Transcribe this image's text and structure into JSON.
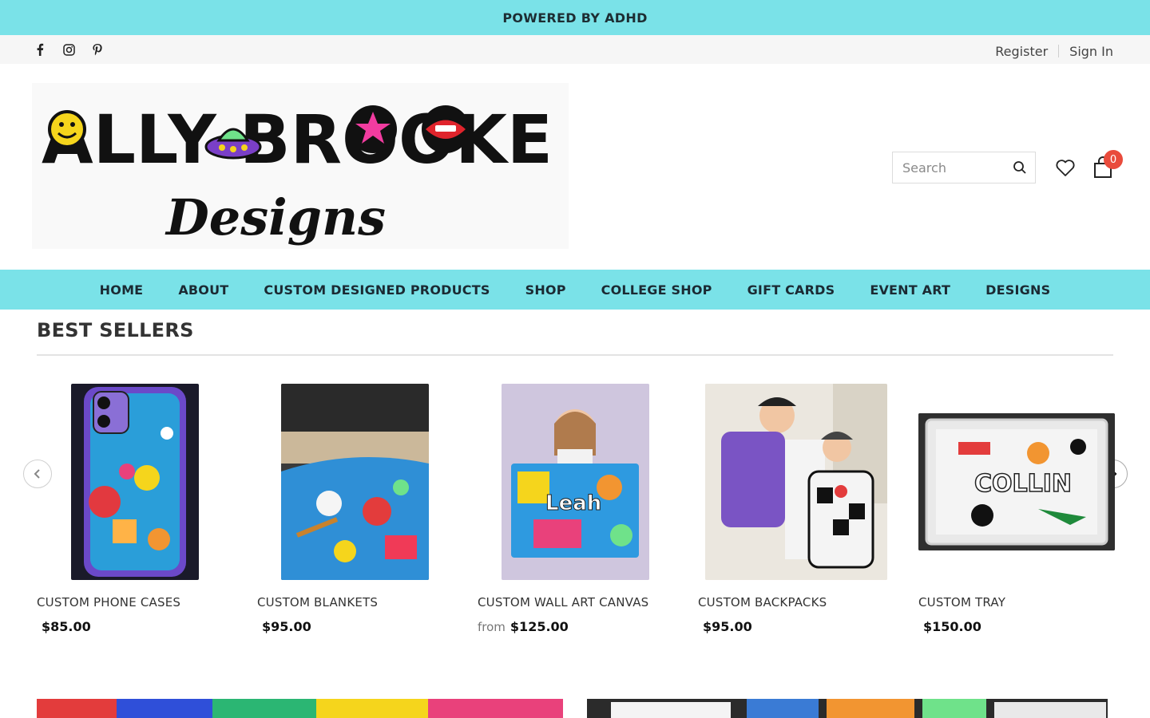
{
  "announcement": "POWERED BY ADHD",
  "social": [
    "facebook-icon",
    "instagram-icon",
    "pinterest-icon"
  ],
  "account": {
    "register": "Register",
    "sign_in": "Sign In"
  },
  "logo": {
    "line1": "ALLY BROOKE",
    "line2": "Designs"
  },
  "search": {
    "placeholder": "Search"
  },
  "cart": {
    "count": "0"
  },
  "nav": [
    "HOME",
    "ABOUT",
    "CUSTOM DESIGNED PRODUCTS",
    "SHOP",
    "COLLEGE SHOP",
    "GIFT CARDS",
    "EVENT ART",
    "DESIGNS"
  ],
  "best_sellers": {
    "title": "BEST SELLERS",
    "products": [
      {
        "title": "CUSTOM PHONE CASES",
        "price": "$85.00",
        "from": ""
      },
      {
        "title": "CUSTOM BLANKETS",
        "price": "$95.00",
        "from": ""
      },
      {
        "title": "CUSTOM WALL ART CANVAS",
        "price": "$125.00",
        "from": "from"
      },
      {
        "title": "CUSTOM BACKPACKS",
        "price": "$95.00",
        "from": ""
      },
      {
        "title": "CUSTOM TRAY",
        "price": "$150.00",
        "from": ""
      }
    ]
  },
  "colors": {
    "accent": "#7ae2e8",
    "badge": "#e94b3c"
  }
}
